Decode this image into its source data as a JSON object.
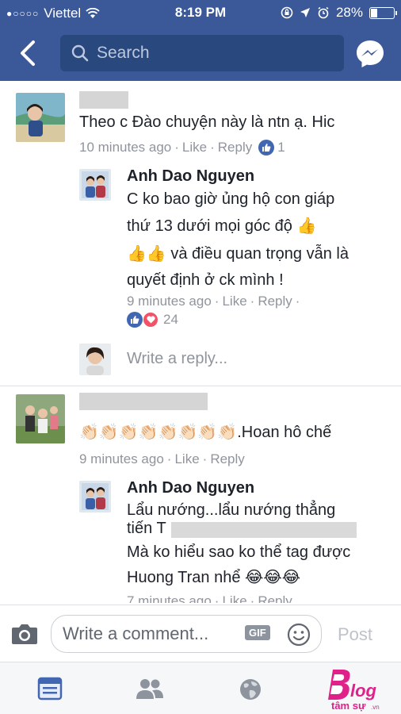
{
  "status_bar": {
    "carrier": "Viettel",
    "time": "8:19 PM",
    "battery": "28%",
    "battery_level": 0.28
  },
  "nav": {
    "search_placeholder": "Search"
  },
  "comments": [
    {
      "text": "Theo c Đào chuyện này là ntn ạ. Hic",
      "time": "10 minutes ago",
      "like": "Like",
      "reply": "Reply",
      "reactions": "1",
      "replies": [
        {
          "name": "Anh Dao Nguyen",
          "lines": [
            "C ko bao giờ ủng hộ con giáp",
            "thứ 13 dưới mọi góc độ 👍",
            "👍👍 và điều quan trọng vẫn là",
            "quyết định ở ck mình !"
          ],
          "time": "9 minutes ago",
          "like": "Like",
          "reply": "Reply",
          "reactions": "24"
        }
      ],
      "write_reply": "Write a reply..."
    },
    {
      "text": "👏🏻👏🏻👏🏻👏🏻👏🏻👏🏻👏🏻👏🏻.Hoan hô chế",
      "time": "9 minutes ago",
      "like": "Like",
      "reply": "Reply",
      "replies": [
        {
          "name": "Anh Dao Nguyen",
          "lines": [
            "Lẩu nướng...lẩu nướng thẳng",
            "tiến T",
            "Mà ko hiểu sao ko thể tag được",
            "Huong Tran nhể 😂😂😂"
          ],
          "time": "7 minutes ago",
          "like": "Like",
          "reply": "Reply"
        }
      ]
    }
  ],
  "composer": {
    "placeholder": "Write a comment...",
    "gif_label": "GIF",
    "post_label": "Post"
  },
  "colors": {
    "brand": "#3b5998",
    "search_bg": "#29487d",
    "meta_gray": "#90949c",
    "like_blue": "#4267b2",
    "heart_red": "#f25268"
  },
  "icons": [
    "back-chevron-icon",
    "search-icon",
    "messenger-icon",
    "camera-icon",
    "smiley-icon",
    "news-feed-icon",
    "friends-icon",
    "globe-icon"
  ]
}
